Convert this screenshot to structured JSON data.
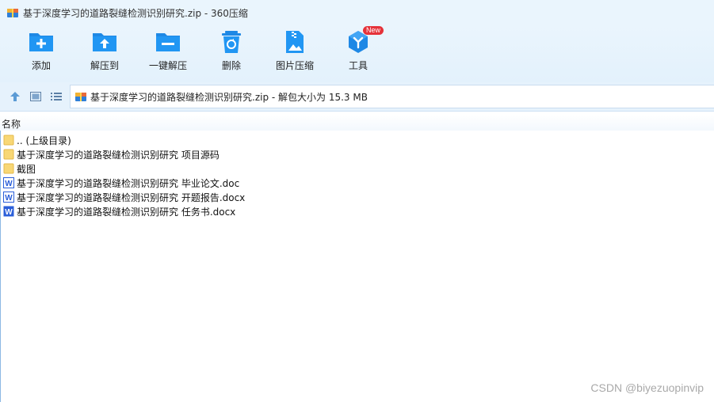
{
  "window": {
    "title": "基于深度学习的道路裂缝检测识别研究.zip - 360压缩"
  },
  "toolbar": {
    "items": [
      {
        "label": "添加",
        "icon": "add-folder-icon"
      },
      {
        "label": "解压到",
        "icon": "extract-to-icon"
      },
      {
        "label": "一键解压",
        "icon": "one-click-extract-icon"
      },
      {
        "label": "删除",
        "icon": "delete-icon"
      },
      {
        "label": "图片压缩",
        "icon": "image-compress-icon"
      },
      {
        "label": "工具",
        "icon": "tools-icon",
        "badge": "New"
      }
    ]
  },
  "navbar": {
    "path": "基于深度学习的道路裂缝检测识别研究.zip - 解包大小为 15.3 MB"
  },
  "list": {
    "column_name": "名称",
    "files": [
      {
        "name": ".. (上级目录)",
        "type": "folder"
      },
      {
        "name": "基于深度学习的道路裂缝检测识别研究 项目源码",
        "type": "folder"
      },
      {
        "name": "截图",
        "type": "folder"
      },
      {
        "name": "基于深度学习的道路裂缝检测识别研究 毕业论文.doc",
        "type": "word"
      },
      {
        "name": "基于深度学习的道路裂缝检测识别研究 开题报告.docx",
        "type": "word"
      },
      {
        "name": "基于深度学习的道路裂缝检测识别研究 任务书.docx",
        "type": "word"
      }
    ]
  },
  "watermark": "CSDN @biyezuopinvip",
  "colors": {
    "accent": "#1e88e5",
    "toolbar_bg": "#e3f1fc",
    "folder": "#f8d775",
    "word": "#2b5fd9",
    "badge": "#e5323a"
  }
}
